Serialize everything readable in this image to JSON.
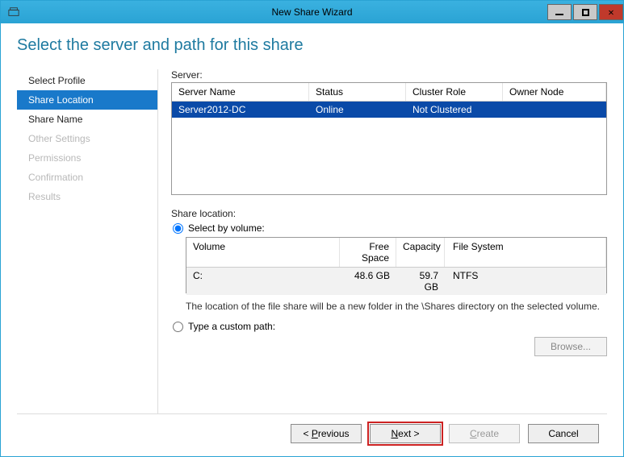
{
  "window": {
    "title": "New Share Wizard"
  },
  "pageTitle": "Select the server and path for this share",
  "steps": [
    {
      "label": "Select Profile",
      "state": "normal"
    },
    {
      "label": "Share Location",
      "state": "active"
    },
    {
      "label": "Share Name",
      "state": "normal"
    },
    {
      "label": "Other Settings",
      "state": "disabled"
    },
    {
      "label": "Permissions",
      "state": "disabled"
    },
    {
      "label": "Confirmation",
      "state": "disabled"
    },
    {
      "label": "Results",
      "state": "disabled"
    }
  ],
  "server": {
    "label": "Server:",
    "columns": {
      "name": "Server Name",
      "status": "Status",
      "role": "Cluster Role",
      "owner": "Owner Node"
    },
    "rows": [
      {
        "name": "Server2012-DC",
        "status": "Online",
        "role": "Not Clustered",
        "owner": "",
        "selected": true
      }
    ]
  },
  "location": {
    "label": "Share location:",
    "optionVolume": "Select by volume:",
    "optionCustom": "Type a custom path:",
    "selectedOption": "volume",
    "volumeColumns": {
      "volume": "Volume",
      "free": "Free Space",
      "capacity": "Capacity",
      "fs": "File System"
    },
    "volumes": [
      {
        "volume": "C:",
        "free": "48.6 GB",
        "capacity": "59.7 GB",
        "fs": "NTFS"
      }
    ],
    "helpText": "The location of the file share will be a new folder in the \\Shares directory on the selected volume.",
    "browseLabel": "Browse..."
  },
  "buttons": {
    "previous": "< Previous",
    "next": "Next >",
    "create": "Create",
    "cancel": "Cancel"
  }
}
